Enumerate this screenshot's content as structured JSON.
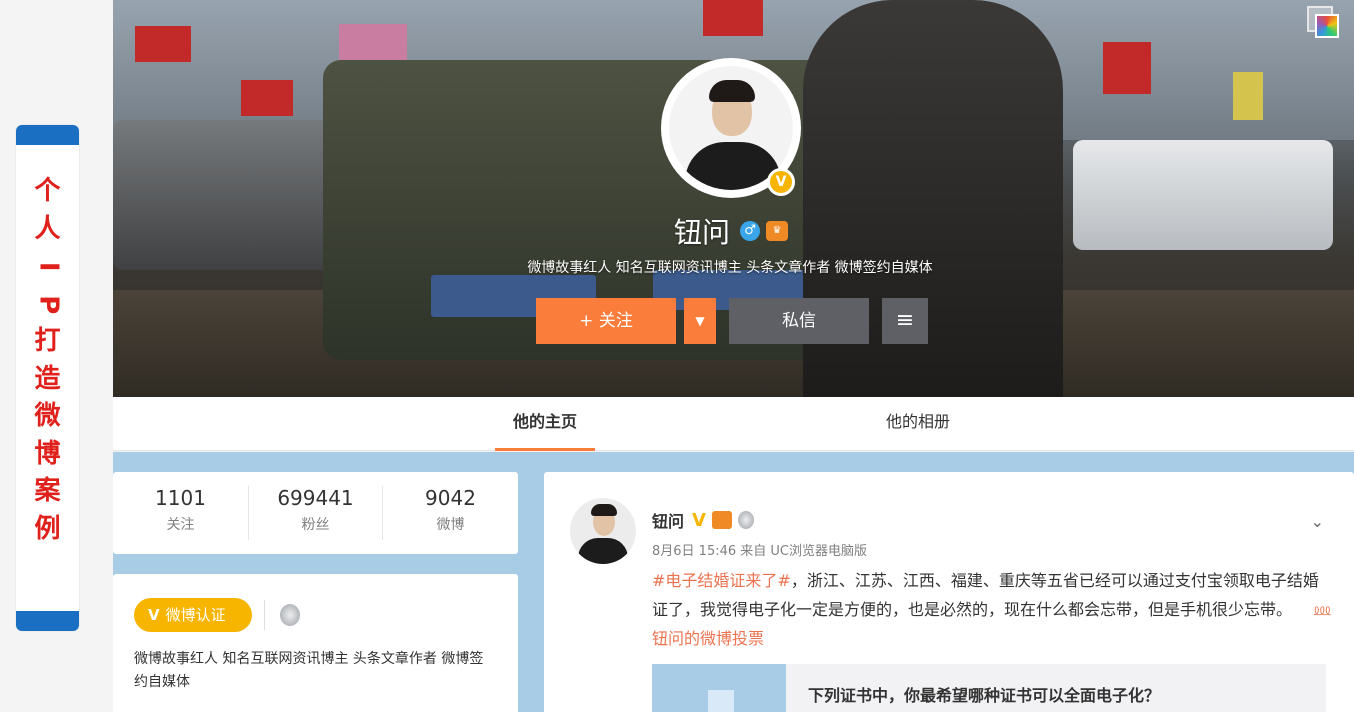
{
  "slide": {
    "side_title": "个人IP打造微博案例"
  },
  "profile": {
    "name": "钮问",
    "verified_badge": "V",
    "bio": "微博故事红人 知名互联网资讯博主 头条文章作者 微博签约自媒体",
    "follow_label": "+ 关注",
    "dropdown_label": "▼",
    "message_label": "私信",
    "menu_label": "≡"
  },
  "tabs": {
    "home": "他的主页",
    "album": "他的相册"
  },
  "stats": [
    {
      "value": "1101",
      "label": "关注"
    },
    {
      "value": "699441",
      "label": "粉丝"
    },
    {
      "value": "9042",
      "label": "微博"
    }
  ],
  "verification": {
    "mark": "V",
    "label": "微博认证",
    "description": "微博故事红人 知名互联网资讯博主 头条文章作者 微博签约自媒体"
  },
  "post": {
    "author": "钮问",
    "v_mark": "V",
    "meta": "8月6日 15:46 来自 UC浏览器电脑版",
    "hashtag": "#电子结婚证来了#",
    "body": "，浙江、江苏、江西、福建、重庆等五省已经可以通过支付宝领取电子结婚证了，我觉得电子化一定是方便的，也是必然的，现在什么都会忘带，但是手机很少忘带。",
    "vote_link": "⅏ 钮问的微博投票",
    "chevron": "⌄",
    "poll_title": "下列证书中，你最希望哪种证书可以全面电子化？"
  },
  "colors": {
    "accent_orange": "#fa7d3c",
    "verify_gold": "#f7b500",
    "slide_red": "#e0201b",
    "slide_blue": "#1b6fc2",
    "content_bg": "#a8cbe6"
  }
}
